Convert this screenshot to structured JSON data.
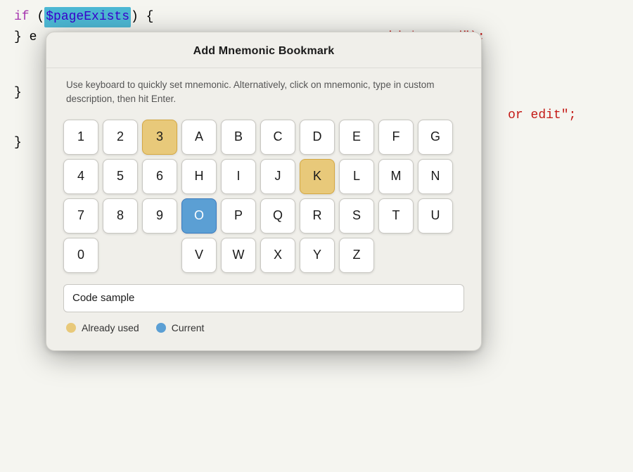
{
  "code": {
    "line1_keyword": "if",
    "line1_var_highlight": "$pageExists",
    "line1_brace": "{",
    "line2_left": "} e",
    "line3_right": "id=$pageId\");",
    "line4_brace_close": "}",
    "line5_string": "or edit\";",
    "line6_brace": "}"
  },
  "dialog": {
    "title": "Add Mnemonic Bookmark",
    "description": "Use keyboard to quickly set mnemonic. Alternatively, click on mnemonic, type in custom description, then hit Enter.",
    "input_value": "Code sample",
    "input_placeholder": "Code sample"
  },
  "keyboard": {
    "rows": [
      [
        "1",
        "2",
        "3",
        "A",
        "B",
        "C",
        "D",
        "E",
        "F",
        "G"
      ],
      [
        "4",
        "5",
        "6",
        "H",
        "I",
        "J",
        "K",
        "L",
        "M",
        "N"
      ],
      [
        "7",
        "8",
        "9",
        "O",
        "P",
        "Q",
        "R",
        "S",
        "T",
        "U"
      ],
      [
        "0",
        "",
        "",
        "V",
        "W",
        "X",
        "Y",
        "Z"
      ]
    ],
    "already_used": [
      "3",
      "K"
    ],
    "current": [
      "O"
    ]
  },
  "legend": {
    "already_used_label": "Already used",
    "current_label": "Current"
  }
}
